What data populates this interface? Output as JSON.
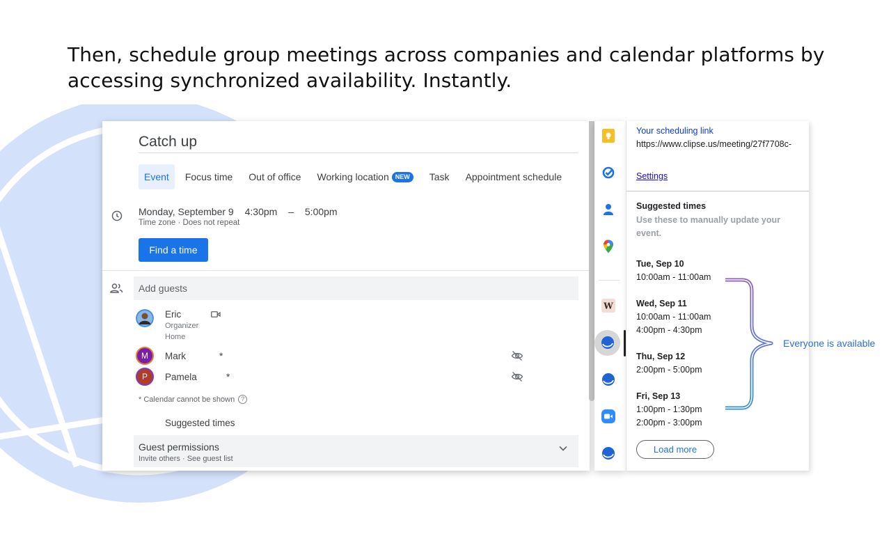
{
  "headline": "Then, schedule group meetings across companies and calendar platforms by accessing synchronized availability. Instantly.",
  "event": {
    "title": "Catch up",
    "tabs": [
      {
        "label": "Event",
        "active": true
      },
      {
        "label": "Focus time"
      },
      {
        "label": "Out of office"
      },
      {
        "label": "Working location",
        "badge": "NEW"
      },
      {
        "label": "Task"
      },
      {
        "label": "Appointment schedule"
      }
    ],
    "date": "Monday, September 9",
    "start": "4:30pm",
    "dash": "–",
    "end": "5:00pm",
    "subline": "Time zone · Does not repeat",
    "find_time": "Find a time",
    "add_guests_placeholder": "Add guests",
    "guests": [
      {
        "name": "Eric",
        "role": "Organizer",
        "location": "Home"
      },
      {
        "initial": "M",
        "name": "Mark",
        "mark": "*",
        "color": "#7b1fa2"
      },
      {
        "initial": "P",
        "name": "Pamela",
        "mark": "*",
        "color": "#b23a2a"
      }
    ],
    "calendar_note": "* Calendar cannot be shown",
    "suggested_times_label": "Suggested times",
    "guest_permissions": {
      "title": "Guest permissions",
      "sub": "Invite others · See guest list"
    }
  },
  "panel": {
    "link_label": "Your scheduling link",
    "url": "https://www.clipse.us/meeting/27f7708c-",
    "settings": "Settings",
    "suggested_title": "Suggested times",
    "suggested_desc": "Use these to manually update your event.",
    "days": [
      {
        "day": "Tue, Sep 10",
        "times": [
          "10:00am - 11:00am"
        ]
      },
      {
        "day": "Wed, Sep 11",
        "times": [
          "10:00am - 11:00am",
          "4:00pm - 4:30pm"
        ]
      },
      {
        "day": "Thu, Sep 12",
        "times": [
          "2:00pm - 5:00pm"
        ]
      },
      {
        "day": "Fri, Sep 13",
        "times": [
          "1:00pm - 1:30pm",
          "2:00pm - 3:00pm"
        ]
      }
    ],
    "load_more": "Load more"
  },
  "annotation": "Everyone is available",
  "colors": {
    "accent": "#1a73e8",
    "brace_top": "#8e5cc8",
    "brace_bottom": "#2f8fe0",
    "deco": "#d3e1fb"
  }
}
